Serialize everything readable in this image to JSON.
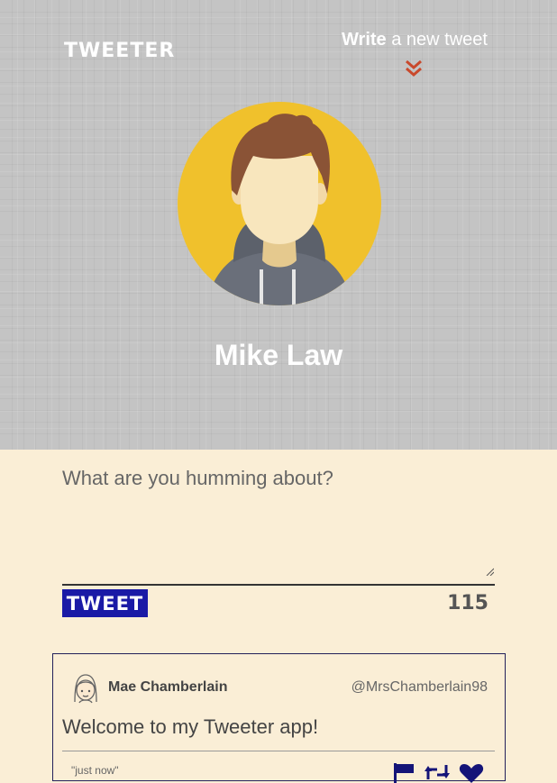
{
  "header": {
    "brand": "TWEETER",
    "compose_link": {
      "bold": "Write",
      "rest": " a new tweet"
    },
    "chevron_icon": "double-chevron-down-icon",
    "chevron_color": "#c9492c",
    "user": {
      "name": "Mike Law",
      "avatar_icon": "user-avatar-icon"
    }
  },
  "compose": {
    "placeholder": "What are you humming about?",
    "value": "",
    "button_label": "TWEET",
    "button_color": "#1a1aa6",
    "char_counter": "115"
  },
  "tweets": [
    {
      "name": "Mae Chamberlain",
      "handle": "@MrsChamberlain98",
      "content": "Welcome to my Tweeter app!",
      "time": "\"just now\"",
      "actions": [
        "flag-icon",
        "retweet-icon",
        "heart-icon"
      ]
    }
  ],
  "colors": {
    "background": "#faeed6",
    "header_bg": "#c4c4c4",
    "avatar_circle": "#f0c12c",
    "action_icons": "#141478"
  }
}
